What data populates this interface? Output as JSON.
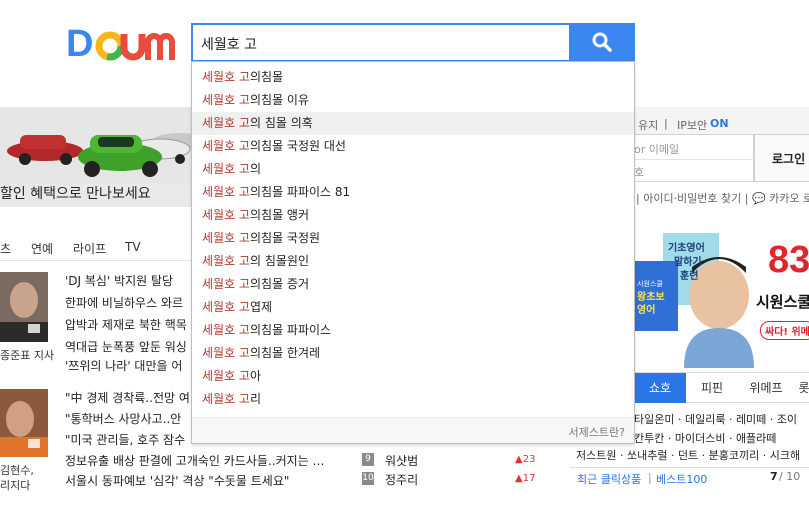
{
  "header": {
    "search_value": "세월호 고",
    "logo_letters": [
      "D",
      "a",
      "u",
      "m"
    ]
  },
  "top_bar": {
    "login_keep": "유지",
    "ip_security": "IP보안",
    "ip_status": "ON",
    "email_placeholder": "or 이메일",
    "email_suffix": "호",
    "login_button": "로그인",
    "links": "| 아이디·비밀번호 찾기 | 💬 카카오 로",
    "accent": "#2a76e6"
  },
  "banner": {
    "text": "할인 혜택으로 만나보세요"
  },
  "nav": {
    "items": [
      "츠",
      "연예",
      "라이프",
      "TV"
    ]
  },
  "news": {
    "block1": [
      "'DJ 복심' 박지원 탈당",
      "한파에 비닐하우스 와르",
      "압박과 제재로 북한 핵목",
      "역대급 눈폭풍 앞둔 워싱",
      "'쯔위의 나라' 대만을 어"
    ],
    "caption1": "종준표 지사",
    "block2": [
      "\"中 경제 경착륙..전망 여",
      "\"통학버스 사망사고..안",
      "\"미국 관리들, 호주 잠수",
      "정보유출 배상 판결에 고개숙인 카드사들..커지는 …",
      "서울시 동파예보 '심각' 격상 \"수돗물 트세요\""
    ],
    "caption2a": "김현수,",
    "caption2b": "리지다"
  },
  "ranking": {
    "rows": [
      {
        "num": "9",
        "name": "워샷범",
        "change": "23"
      },
      {
        "num": "10",
        "name": "정주리",
        "change": "17"
      }
    ]
  },
  "ad": {
    "big_number": "83",
    "title": "시원스쿨",
    "book_text1": "기초영어",
    "book_text2": "말하기",
    "book_text3": "훈련",
    "book_title": "왕초보 영어",
    "book_small": "시원스쿨",
    "cta": "싸다! 위메"
  },
  "shopping": {
    "tabs": [
      "쇼호",
      "피핀",
      "위메프",
      "롯"
    ],
    "line1": "타일온미 · 데일리룩 · 레미떼 · 조이",
    "line2": "칸투칸 · 마이더스비 · 애플라떼",
    "line3": "저스트원 · 쏘내추럴 · 던트 · 분홍코끼리 · 시크해",
    "bottom_recent": "최근 클릭상품",
    "bottom_best": "베스트100",
    "page": "7",
    "page_total": "/ 10"
  },
  "suggestions": {
    "query": "세월호 고",
    "items": [
      {
        "match": "세월호 고",
        "rest": "의침몰"
      },
      {
        "match": "세월호 고",
        "rest": "의침몰 이유"
      },
      {
        "match": "세월호 고",
        "rest": "의 침몰 의혹"
      },
      {
        "match": "세월호 고",
        "rest": "의침몰 국정원 대선"
      },
      {
        "match": "세월호 고",
        "rest": "의"
      },
      {
        "match": "세월호 고",
        "rest": "의침몰 파파이스 81"
      },
      {
        "match": "세월호 고",
        "rest": "의침몰 앵커"
      },
      {
        "match": "세월호 고",
        "rest": "의침몰 국정원"
      },
      {
        "match": "세월호 고",
        "rest": "의 침몰원인"
      },
      {
        "match": "세월호 고",
        "rest": "의침몰 증거"
      },
      {
        "match": "세월호 고",
        "rest": "엽제"
      },
      {
        "match": "세월호 고",
        "rest": "의침몰 파파이스"
      },
      {
        "match": "세월호 고",
        "rest": "의침몰 한겨레"
      },
      {
        "match": "세월호 고",
        "rest": "아"
      },
      {
        "match": "세월호 고",
        "rest": "리"
      }
    ],
    "footer": "서제스트란?"
  }
}
